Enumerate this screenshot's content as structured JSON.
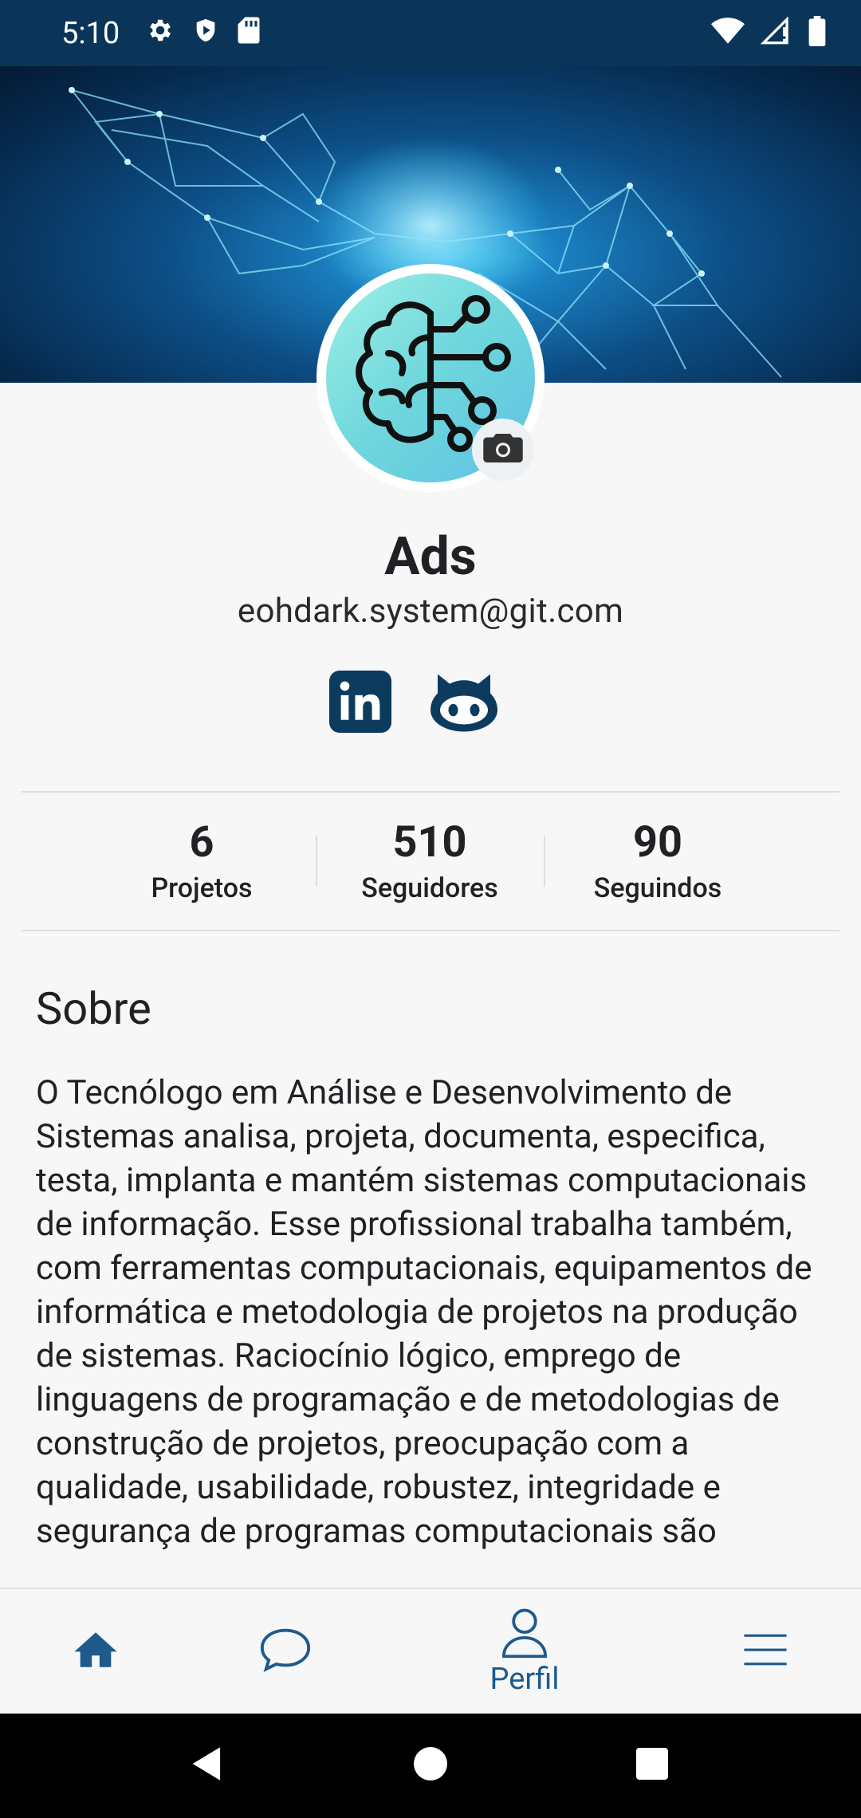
{
  "status_bar": {
    "time": "5:10",
    "left_icons": [
      "gear-icon",
      "shield-icon",
      "sd-card-icon"
    ],
    "right_icons": [
      "wifi-icon",
      "signal-icon",
      "battery-icon"
    ]
  },
  "profile": {
    "name": "Ads",
    "email": "eohdark.system@git.com",
    "avatar_icon": "brain-circuit-icon",
    "social": [
      {
        "name": "linkedin-icon",
        "label": "LinkedIn"
      },
      {
        "name": "github-icon",
        "label": "GitHub"
      }
    ]
  },
  "stats": [
    {
      "value": "6",
      "label": "Projetos"
    },
    {
      "value": "510",
      "label": "Seguidores"
    },
    {
      "value": "90",
      "label": "Seguindos"
    }
  ],
  "about": {
    "title": "Sobre",
    "text": "O Tecnólogo em Análise e Desenvolvimento de Sistemas analisa, projeta, documenta, especifica, testa, implanta e mantém sistemas computacionais de informação. Esse profissional trabalha também, com ferramentas computacionais, equipamentos de informática e metodologia de projetos na produção de sistemas. Raciocínio lógico, emprego de linguagens de programação e de metodologias de construção de projetos, preocupação com a qualidade, usabilidade, robustez, integridade e segurança de programas computacionais são"
  },
  "bottom_nav": {
    "items": [
      {
        "name": "home",
        "icon": "home-icon",
        "label": ""
      },
      {
        "name": "chat",
        "icon": "chat-bubble-icon",
        "label": ""
      },
      {
        "name": "profile",
        "icon": "person-icon",
        "label": "Perfil",
        "active": true
      },
      {
        "name": "menu",
        "icon": "hamburger-menu-icon",
        "label": ""
      }
    ]
  },
  "colors": {
    "status_bar_bg": "#0a3558",
    "accent": "#1e5a8c",
    "icon_dark": "#0d3b5e"
  }
}
